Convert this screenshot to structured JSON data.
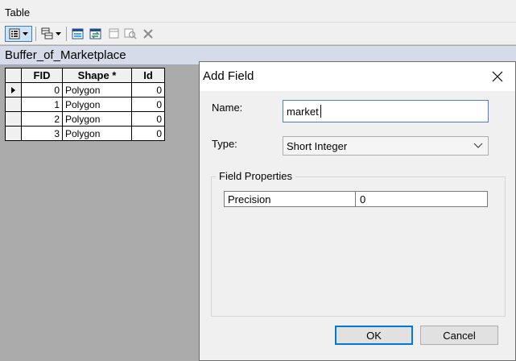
{
  "window": {
    "title": "Table"
  },
  "toolbar": {
    "icons": [
      "table-options-icon",
      "dropdown-arrow-icon",
      "related-tables-icon",
      "select-by-attributes-icon",
      "switch-selection-icon",
      "clear-selection-icon",
      "zoom-to-selected-icon",
      "delete-selected-icon"
    ]
  },
  "table_tab": {
    "title": "Buffer_of_Marketplace"
  },
  "attribute_table": {
    "columns": [
      "FID",
      "Shape *",
      "Id"
    ],
    "rows": [
      {
        "fid": "0",
        "shape": "Polygon",
        "id": "0"
      },
      {
        "fid": "1",
        "shape": "Polygon",
        "id": "0"
      },
      {
        "fid": "2",
        "shape": "Polygon",
        "id": "0"
      },
      {
        "fid": "3",
        "shape": "Polygon",
        "id": "0"
      }
    ]
  },
  "dialog": {
    "title": "Add Field",
    "name_label": "Name:",
    "name_value": "market",
    "type_label": "Type:",
    "type_value": "Short Integer",
    "field_properties_label": "Field Properties",
    "precision_label": "Precision",
    "precision_value": "0",
    "ok_label": "OK",
    "cancel_label": "Cancel"
  },
  "colors": {
    "accent": "#0078d7",
    "tab_background": "#d6dbe9",
    "canvas": "#ababab"
  }
}
